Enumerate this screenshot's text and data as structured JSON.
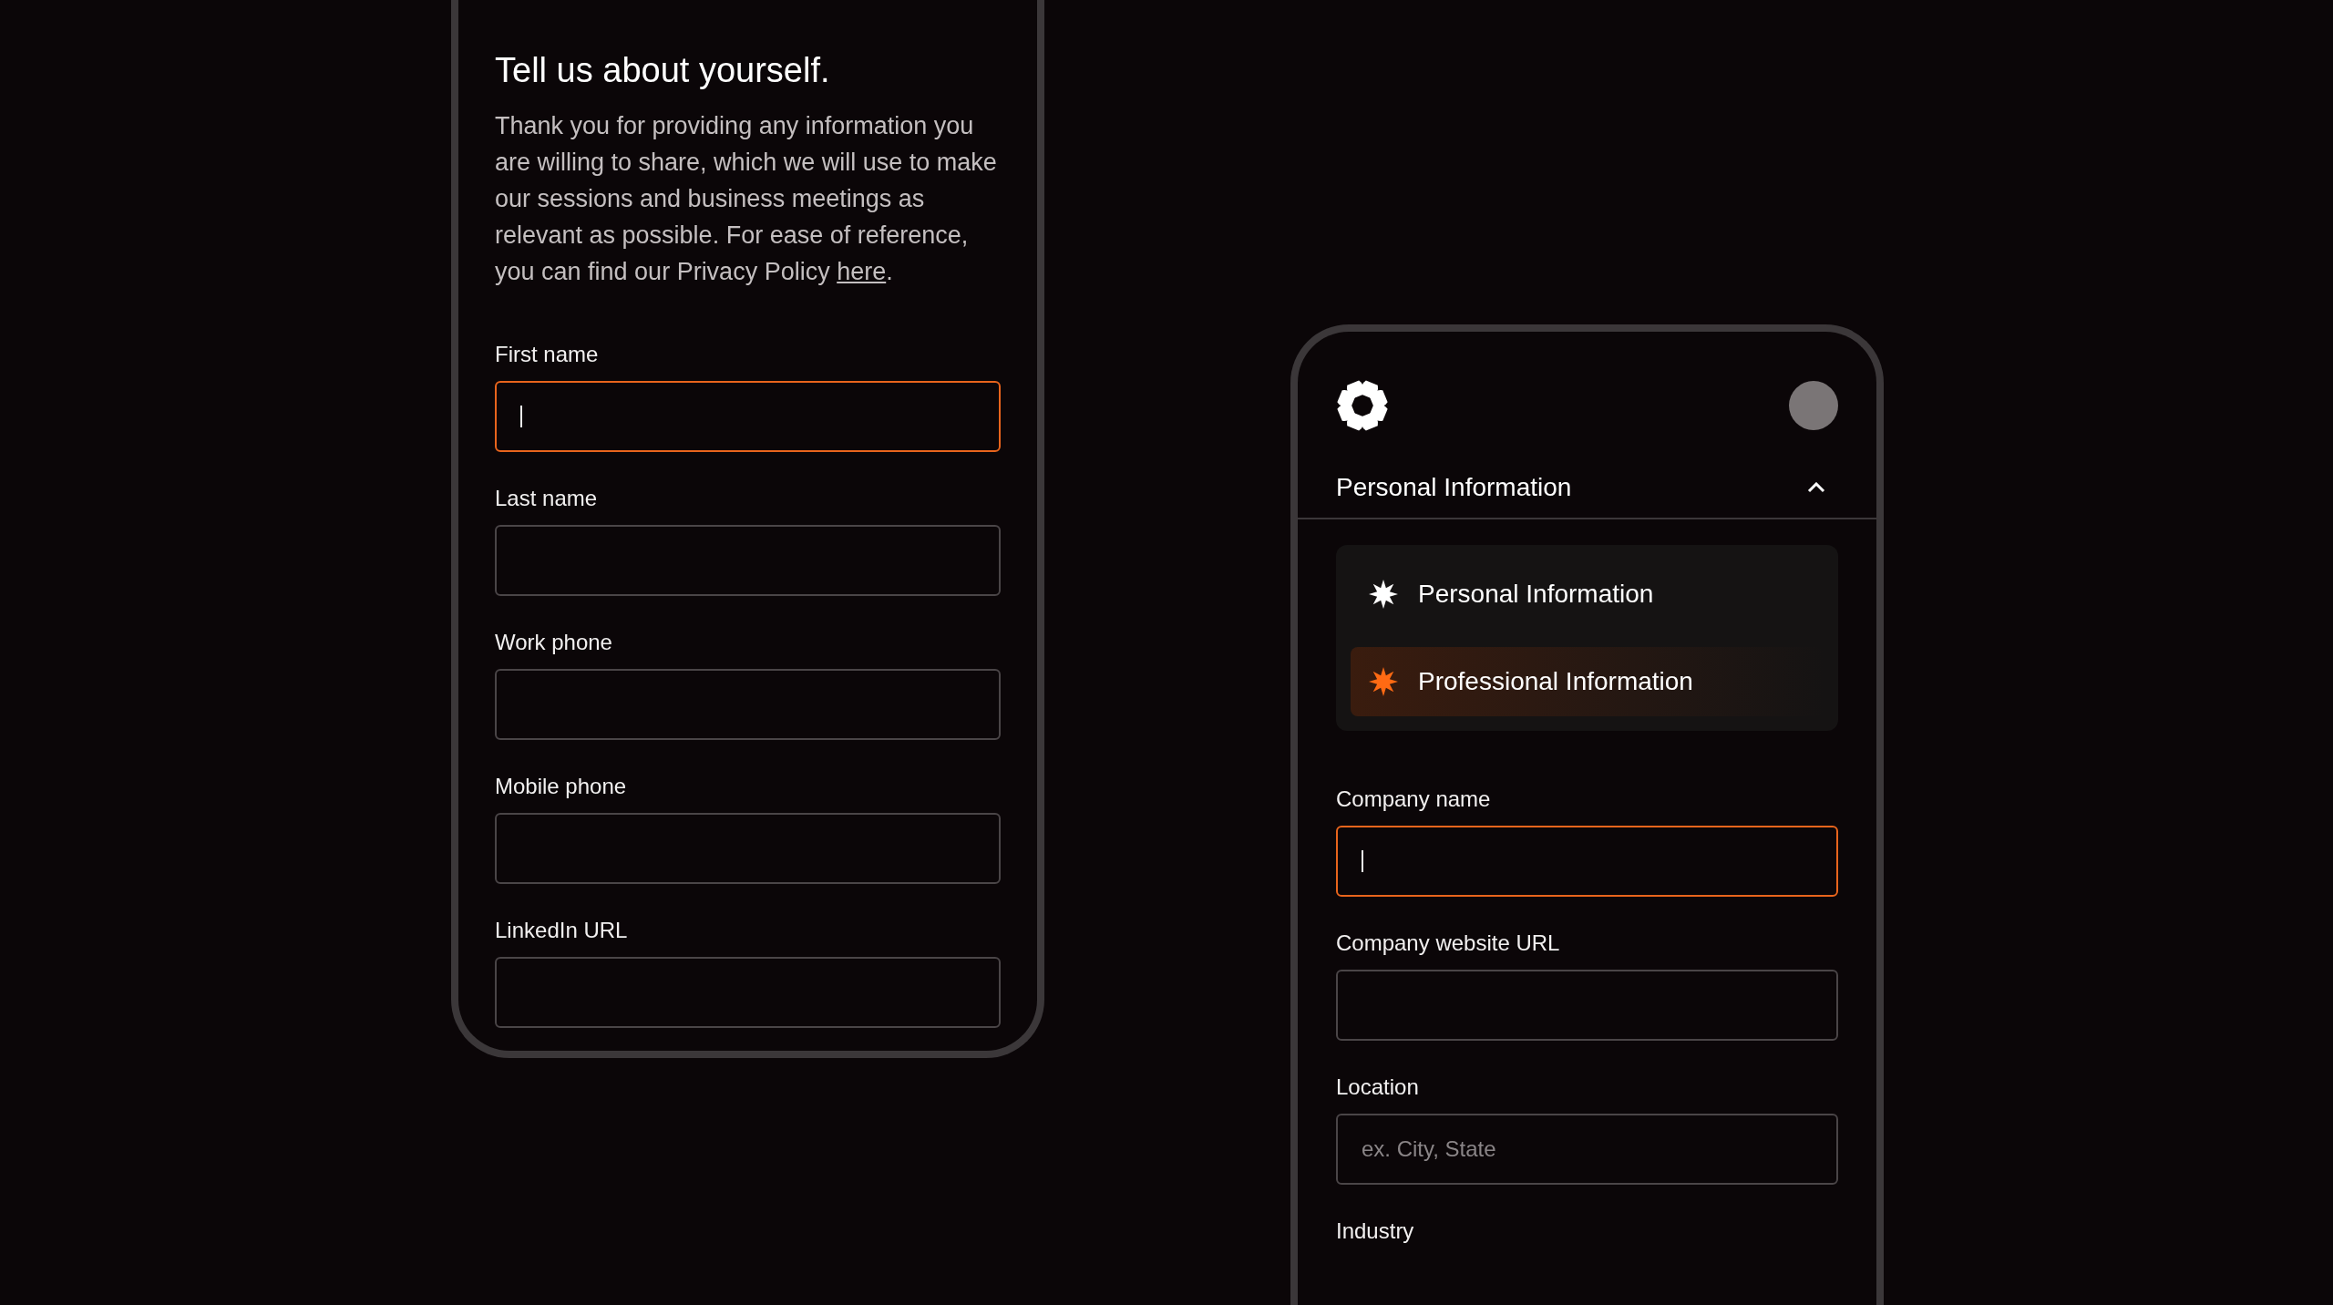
{
  "profile_form": {
    "title": "Tell us about yourself.",
    "intro": {
      "text": "Thank you for providing any information you are willing to share, which we will use to make our sessions and business meetings as relevant as possible. For ease of reference, you can find our Privacy Policy ",
      "link": "here",
      "after": "."
    },
    "fields": [
      {
        "label": "First name",
        "focused": true
      },
      {
        "label": "Last name",
        "focused": false
      },
      {
        "label": "Work phone",
        "focused": false
      },
      {
        "label": "Mobile phone",
        "focused": false
      },
      {
        "label": "LinkedIn URL",
        "focused": false
      }
    ]
  },
  "professional_form": {
    "section_dropdown": {
      "current": "Personal Information",
      "expanded": true,
      "items": [
        {
          "label": "Personal Information",
          "highlighted": false
        },
        {
          "label": "Professional Information",
          "highlighted": true
        }
      ]
    },
    "fields": [
      {
        "label": "Company name",
        "focused": true
      },
      {
        "label": "Company website URL",
        "focused": false
      },
      {
        "label": "Location",
        "focused": false,
        "placeholder": "ex. City, State"
      }
    ],
    "next_label": "Industry"
  }
}
